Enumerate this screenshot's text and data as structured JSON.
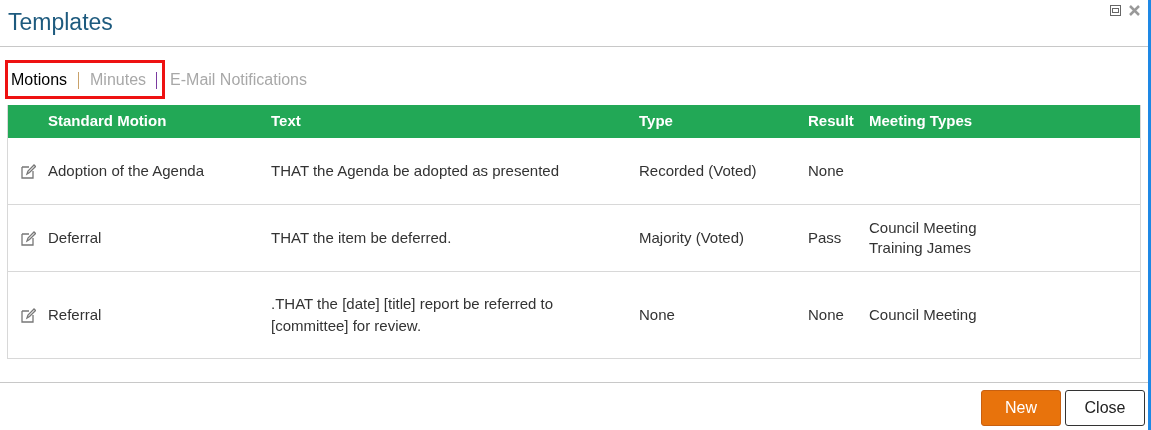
{
  "window": {
    "title": "Templates"
  },
  "tabs": [
    {
      "label": "Motions",
      "selected": true
    },
    {
      "label": "Minutes",
      "selected": false
    },
    {
      "label": "E-Mail Notifications",
      "selected": false
    }
  ],
  "table": {
    "columns": [
      "Standard Motion",
      "Text",
      "Type",
      "Result",
      "Meeting Types"
    ],
    "rows": [
      {
        "name": "Adoption of the Agenda",
        "text": "THAT the Agenda be adopted as presented",
        "type": "Recorded (Voted)",
        "result": "None",
        "meeting_types": []
      },
      {
        "name": "Deferral",
        "text": "THAT the item be deferred.",
        "type": "Majority (Voted)",
        "result": "Pass",
        "meeting_types": [
          "Council Meeting",
          "Training James"
        ]
      },
      {
        "name": "Referral",
        "text": ".THAT the [date] [title] report be referred to [committee] for review.",
        "type": "None",
        "result": "None",
        "meeting_types": [
          "Council Meeting"
        ]
      }
    ]
  },
  "buttons": [
    {
      "label": "New",
      "kind": "primary"
    },
    {
      "label": "Close",
      "kind": "secondary"
    }
  ]
}
